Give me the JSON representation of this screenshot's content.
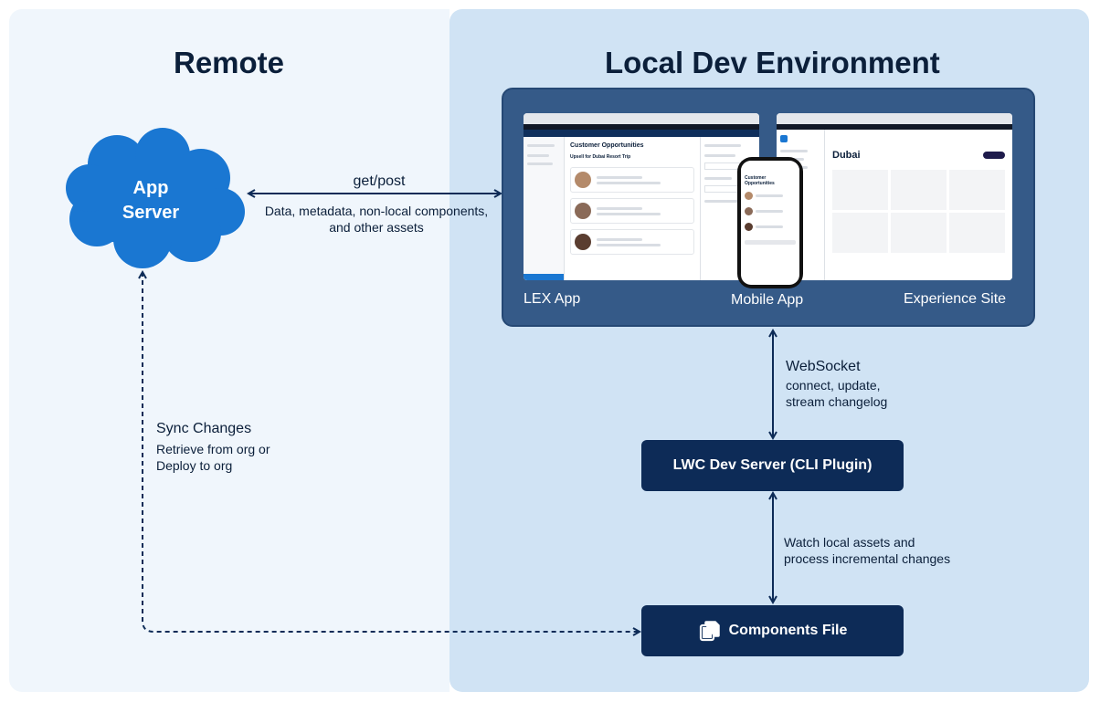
{
  "titles": {
    "remote": "Remote",
    "local": "Local Dev Environment"
  },
  "app_server": {
    "line1": "App",
    "line2": "Server"
  },
  "get_post": {
    "label": "get/post",
    "line1": "Data, metadata, non-local components,",
    "line2": "and other assets"
  },
  "env": {
    "lex_caption": "LEX App",
    "mobile_caption": "Mobile App",
    "site_caption": "Experience Site",
    "lex_card_title": "Customer Opportunities",
    "lex_card_subtitle": "Upsell for Dubai Resort Trip",
    "site_heading": "Dubai"
  },
  "websocket": {
    "title": "WebSocket",
    "line1": "connect, update,",
    "line2": "stream changelog"
  },
  "dev_server": {
    "label": "LWC Dev Server (CLI Plugin)"
  },
  "watch": {
    "line1": "Watch local assets and",
    "line2": "process incremental changes"
  },
  "components": {
    "label": "Components File",
    "icon": "files-icon"
  },
  "sync": {
    "title": "Sync Changes",
    "line1": "Retrieve from org or",
    "line2": "Deploy to org"
  },
  "colors": {
    "cloud": "#1a77d2",
    "dark_box": "#0d2b57",
    "env_box": "#355a88",
    "local_panel": "#d0e3f4",
    "remote_panel": "#f0f6fc"
  }
}
